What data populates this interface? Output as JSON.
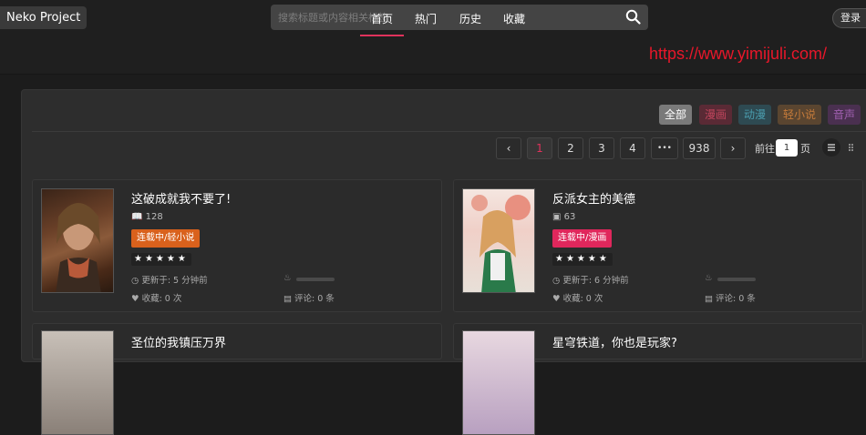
{
  "header": {
    "logo": "Neko Project",
    "search_placeholder": "搜索标题或内容相关标签",
    "login_label": "登录"
  },
  "nav": {
    "tabs": [
      {
        "label": "首页",
        "active": true
      },
      {
        "label": "热门",
        "active": false
      },
      {
        "label": "历史",
        "active": false
      },
      {
        "label": "收藏",
        "active": false
      }
    ]
  },
  "watermark": "https://www.yimijuli.com/",
  "categories": [
    {
      "label": "全部",
      "color": "#7a7a7a",
      "text": "#ffffff"
    },
    {
      "label": "漫画",
      "color": "#5a2a35",
      "text": "#c0455c"
    },
    {
      "label": "动漫",
      "color": "#2e4a52",
      "text": "#4a9cad"
    },
    {
      "label": "轻小说",
      "color": "#5a4530",
      "text": "#c47a3a"
    },
    {
      "label": "音声",
      "color": "#4a3050",
      "text": "#a060b0"
    }
  ],
  "pagination": {
    "prev": "‹",
    "pages": [
      "1",
      "2",
      "3",
      "4",
      "•••",
      "938"
    ],
    "current": "1",
    "next": "›",
    "goto_prefix": "前往",
    "goto_value": "1",
    "goto_suffix": "页"
  },
  "works": [
    {
      "title": "这破成就我不要了!",
      "count": "128",
      "badge": "连载中/轻小说",
      "badge_color": "#d9611c",
      "rating": "★★★★★",
      "updated": "更新于: 5 分钟前",
      "favorites": "收藏: 0 次",
      "comments": "评论: 0 条"
    },
    {
      "title": "反派女主的美德",
      "count": "63",
      "badge": "连载中/漫画",
      "badge_color": "#e0275c",
      "rating": "★★★★★",
      "updated": "更新于: 6 分钟前",
      "favorites": "收藏: 0 次",
      "comments": "评论: 0 条"
    },
    {
      "title": "圣位的我镇压万界"
    },
    {
      "title": "星穹铁道，你也是玩家?"
    }
  ]
}
